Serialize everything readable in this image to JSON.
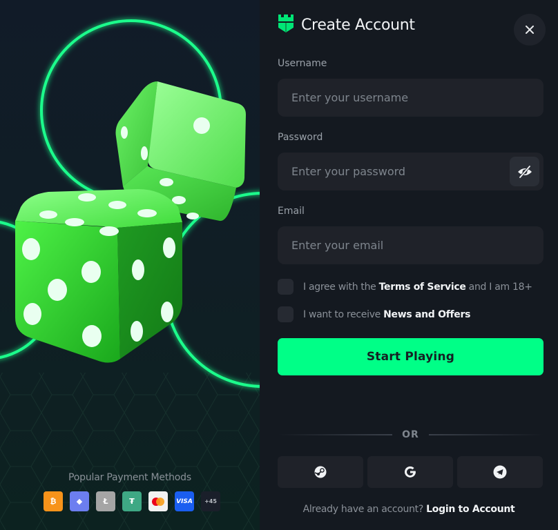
{
  "header": {
    "title": "Create Account",
    "logo_icon": "castle-shield-icon",
    "close_icon": "close-icon"
  },
  "form": {
    "username": {
      "label": "Username",
      "placeholder": "Enter your username",
      "value": ""
    },
    "password": {
      "label": "Password",
      "placeholder": "Enter your password",
      "value": "",
      "toggle_icon": "eye-off-icon"
    },
    "email": {
      "label": "Email",
      "placeholder": "Enter your email",
      "value": ""
    },
    "terms": {
      "prefix": "I agree with the ",
      "link": "Terms of Service",
      "suffix": " and I am 18+",
      "checked": false
    },
    "news": {
      "prefix": "I want to receive ",
      "link": "News and Offers",
      "checked": false
    },
    "submit_label": "Start Playing"
  },
  "divider": {
    "text": "OR"
  },
  "social_login": [
    {
      "name": "Steam",
      "icon": "steam-icon"
    },
    {
      "name": "Google",
      "icon": "google-icon"
    },
    {
      "name": "Telegram",
      "icon": "telegram-icon"
    }
  ],
  "footer": {
    "prompt": "Already have an account? ",
    "link": "Login to Account"
  },
  "payments": {
    "title": "Popular Payment Methods",
    "methods": [
      {
        "name": "Bitcoin",
        "glyph": "₿"
      },
      {
        "name": "Ethereum",
        "glyph": "◆"
      },
      {
        "name": "Litecoin",
        "glyph": "Ł"
      },
      {
        "name": "Tether",
        "glyph": "₮"
      },
      {
        "name": "Mastercard",
        "glyph": ""
      },
      {
        "name": "Visa",
        "glyph": "VISA"
      },
      {
        "name": "More",
        "glyph": "+45"
      }
    ]
  },
  "colors": {
    "accent": "#00ff87",
    "panel_bg": "#141920",
    "field_bg": "#1f2229",
    "neon_ring": "#1aff8c"
  }
}
